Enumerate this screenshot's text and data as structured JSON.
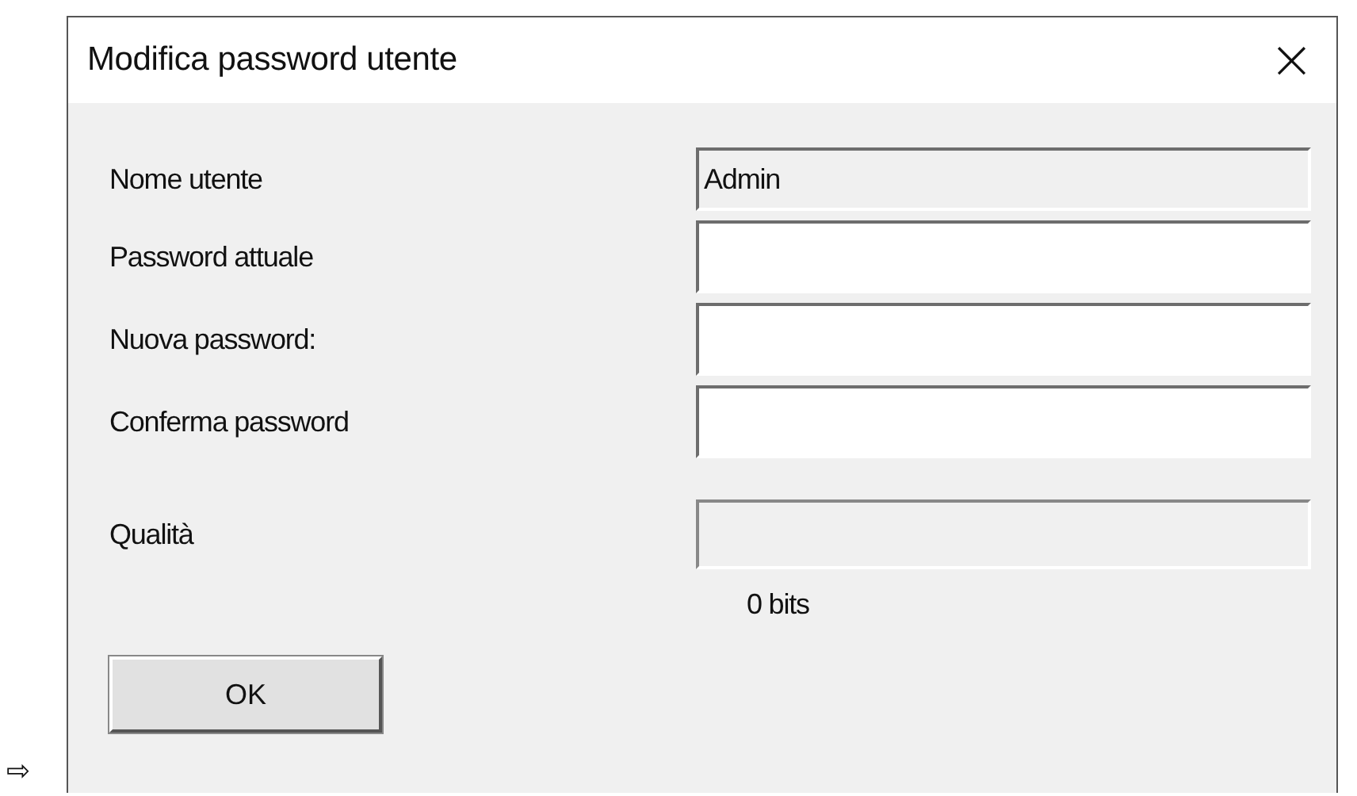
{
  "pointer": "⇨",
  "window": {
    "title": "Modifica password utente",
    "close": "×"
  },
  "fields": [
    {
      "label": "Nome utente",
      "value": "Admin",
      "disabled": true
    },
    {
      "label": "Password attuale",
      "disabled": false
    },
    {
      "label": "Nuova password:",
      "disabled": false
    },
    {
      "label": "Conferma password",
      "disabled": false
    }
  ],
  "quality": {
    "label": "Qualità",
    "level": 0,
    "reading": "0 bits"
  },
  "buttons": [
    "OK"
  ]
}
